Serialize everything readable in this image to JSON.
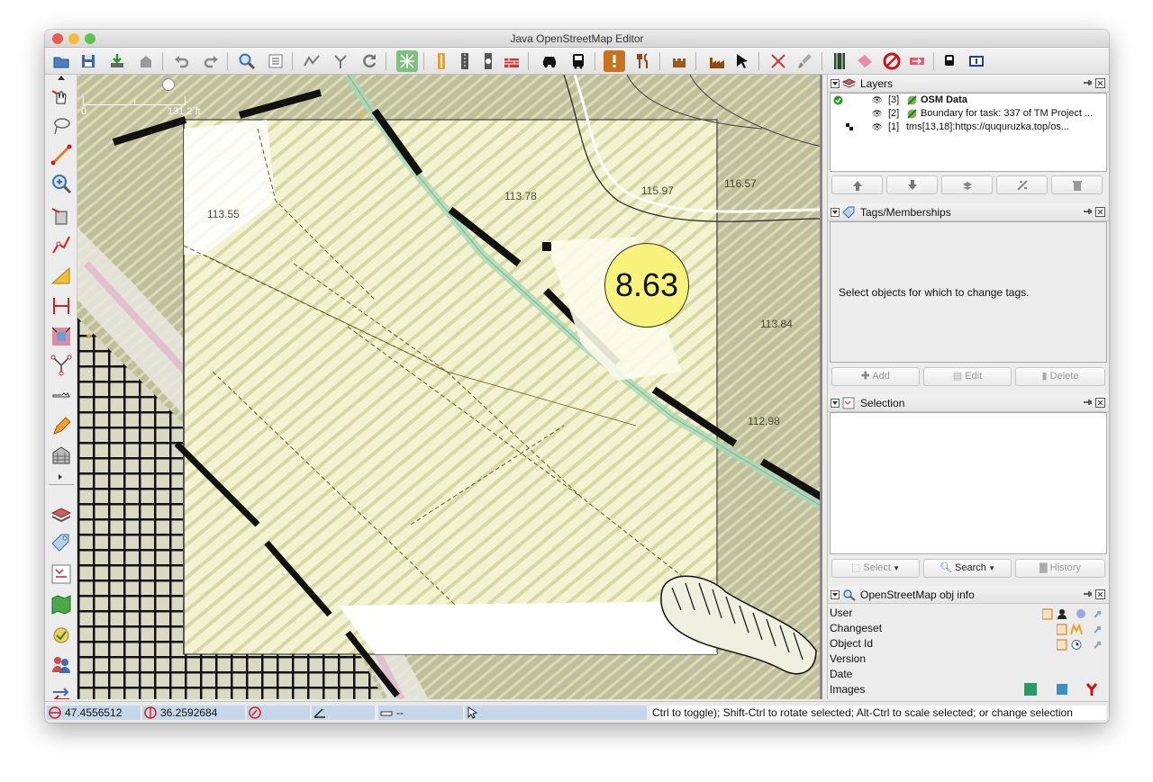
{
  "window": {
    "title": "Java OpenStreetMap Editor"
  },
  "map": {
    "scale_zero": "0",
    "scale_label": "131.2 ft",
    "elevations": [
      "113.55",
      "113.78",
      "115.97",
      "116.57",
      "113.84",
      "112.98"
    ],
    "marker_value": "8.63"
  },
  "layers": {
    "title": "Layers",
    "rows": [
      {
        "index": "[3]",
        "name": "OSM Data",
        "active": true
      },
      {
        "index": "[2]",
        "name": "Boundary for task: 337 of TM Project ...",
        "active": false
      },
      {
        "index": "[1]",
        "name": "tms[13,18]:https://ququruzka.top/os...",
        "active": false
      }
    ]
  },
  "tags": {
    "title": "Tags/Memberships",
    "empty_message": "Select objects for which to change tags.",
    "add_label": "Add",
    "edit_label": "Edit",
    "delete_label": "Delete"
  },
  "selection": {
    "title": "Selection",
    "select_label": "Select",
    "search_label": "Search",
    "history_label": "History"
  },
  "objinfo": {
    "title": "OpenStreetMap obj info",
    "rows": [
      "User",
      "Changeset",
      "Object Id",
      "Version",
      "Date",
      "Images"
    ]
  },
  "status": {
    "lat": "47.4556512",
    "lon": "36.2592684",
    "distance": "--",
    "message": "Ctrl to toggle); Shift-Ctrl to rotate selected; Alt-Ctrl to scale selected; or change selection"
  },
  "colors": {
    "map_yellow": "#efefc4",
    "map_hatch": "#bdbd9c",
    "marker_fill": "#f7f27a",
    "status_field": "#c6d7ea"
  }
}
